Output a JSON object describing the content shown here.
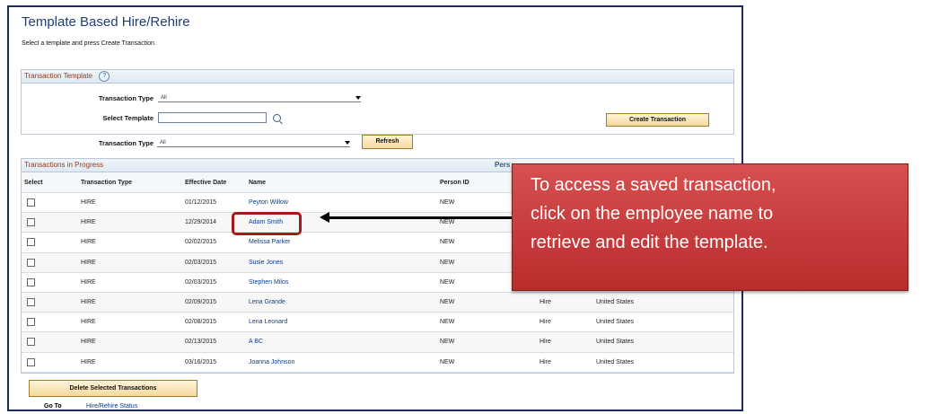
{
  "page": {
    "title": "Template Based Hire/Rehire",
    "instructions": "Select a template and press Create Transaction."
  },
  "template_section": {
    "title": "Transaction Template",
    "help": "?",
    "transaction_type_label": "Transaction Type",
    "transaction_type_value": "All",
    "select_template_label": "Select Template",
    "select_template_value": "",
    "create_button": "Create Transaction"
  },
  "filter": {
    "transaction_type_label": "Transaction Type",
    "transaction_type_value": "All",
    "refresh_button": "Refresh"
  },
  "progress": {
    "title": "Transactions in Progress",
    "header_right": "Pers",
    "columns": [
      "Select",
      "Transaction Type",
      "Effective Date",
      "Name",
      "Person ID"
    ],
    "rows": [
      [
        "HIRE",
        "01/12/2015",
        "Peyton Willow",
        "NEW",
        "",
        ""
      ],
      [
        "HIRE",
        "12/29/2014",
        "Adam Smith",
        "NEW",
        "",
        ""
      ],
      [
        "HIRE",
        "02/02/2015",
        "Melissa Parker",
        "NEW",
        "",
        ""
      ],
      [
        "HIRE",
        "02/03/2015",
        "Susie Jones",
        "NEW",
        "",
        ""
      ],
      [
        "HIRE",
        "02/03/2015",
        "Stephen Milos",
        "NEW",
        "",
        ""
      ],
      [
        "HIRE",
        "02/09/2015",
        "Lena Grande",
        "NEW",
        "Hire",
        "United States"
      ],
      [
        "HIRE",
        "02/08/2015",
        "Lena Leonard",
        "NEW",
        "Hire",
        "United States"
      ],
      [
        "HIRE",
        "02/13/2015",
        "A BC",
        "NEW",
        "Hire",
        "United States"
      ],
      [
        "HIRE",
        "03/16/2015",
        "Joanna Johnson",
        "NEW",
        "Hire",
        "United States"
      ]
    ],
    "delete_button": "Delete Selected Transactions"
  },
  "footer": {
    "goto_label": "Go To",
    "goto_link": "Hire/Rehire Status"
  },
  "callout": {
    "text": "To access a saved transaction,\nclick on the employee name to\nretrieve and edit the template."
  },
  "colors": {
    "callout": "#c83a3a",
    "title": "#1f3f73",
    "link": "#0c3c87"
  }
}
